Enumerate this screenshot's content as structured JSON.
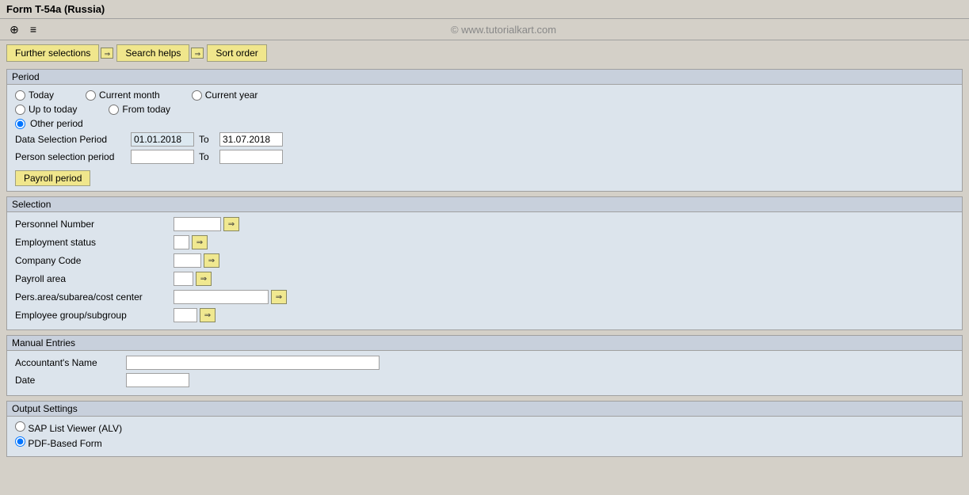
{
  "title": "Form T-54a (Russia)",
  "watermark": "© www.tutorialkart.com",
  "toolbar": {
    "icon1": "⊕",
    "icon2": "≡"
  },
  "buttons": {
    "further_selections": "Further selections",
    "search_helps": "Search helps",
    "sort_order": "Sort order"
  },
  "period_section": {
    "header": "Period",
    "radio_today": "Today",
    "radio_current_month": "Current month",
    "radio_current_year": "Current year",
    "radio_up_to_today": "Up to today",
    "radio_from_today": "From today",
    "radio_other_period": "Other period",
    "data_selection_period_label": "Data Selection Period",
    "data_selection_from": "01.01.2018",
    "to_label": "To",
    "data_selection_to": "31.07.2018",
    "person_selection_period_label": "Person selection period",
    "person_from": "",
    "person_to": "",
    "payroll_period_btn": "Payroll period"
  },
  "selection_section": {
    "header": "Selection",
    "rows": [
      {
        "label": "Personnel Number",
        "value": "",
        "width": "60"
      },
      {
        "label": "Employment status",
        "value": "",
        "width": "20"
      },
      {
        "label": "Company Code",
        "value": "",
        "width": "35"
      },
      {
        "label": "Payroll area",
        "value": "",
        "width": "25"
      },
      {
        "label": "Pers.area/subarea/cost center",
        "value": "",
        "width": "120"
      },
      {
        "label": "Employee group/subgroup",
        "value": "",
        "width": "30"
      }
    ]
  },
  "manual_entries_section": {
    "header": "Manual Entries",
    "accountants_name_label": "Accountant's Name",
    "accountants_name_value": "",
    "date_label": "Date",
    "date_value": ""
  },
  "output_settings_section": {
    "header": "Output Settings",
    "radio_alv": "SAP List Viewer (ALV)",
    "radio_pdf": "PDF-Based Form"
  }
}
